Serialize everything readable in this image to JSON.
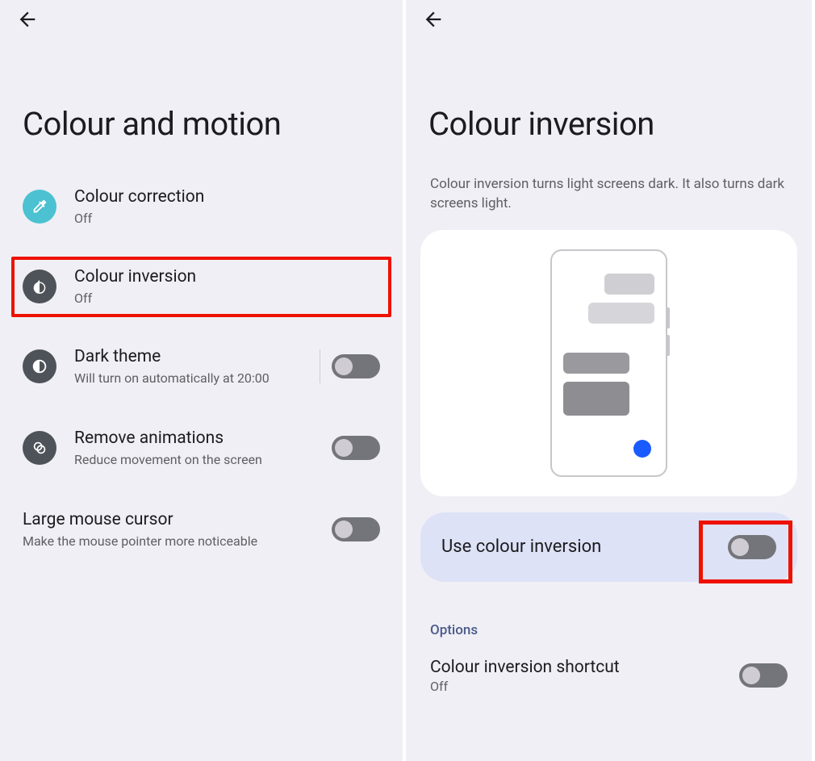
{
  "left": {
    "title": "Colour and motion",
    "items": [
      {
        "title": "Colour correction",
        "sub": "Off"
      },
      {
        "title": "Colour inversion",
        "sub": "Off"
      },
      {
        "title": "Dark theme",
        "sub": "Will turn on automatically at 20:00"
      },
      {
        "title": "Remove animations",
        "sub": "Reduce movement on the screen"
      },
      {
        "title": "Large mouse cursor",
        "sub": "Make the mouse pointer more noticeable"
      }
    ]
  },
  "right": {
    "title": "Colour inversion",
    "desc": "Colour inversion turns light screens dark. It also turns dark screens light.",
    "use_label": "Use colour inversion",
    "options_label": "Options",
    "shortcut": {
      "title": "Colour inversion shortcut",
      "sub": "Off"
    }
  }
}
